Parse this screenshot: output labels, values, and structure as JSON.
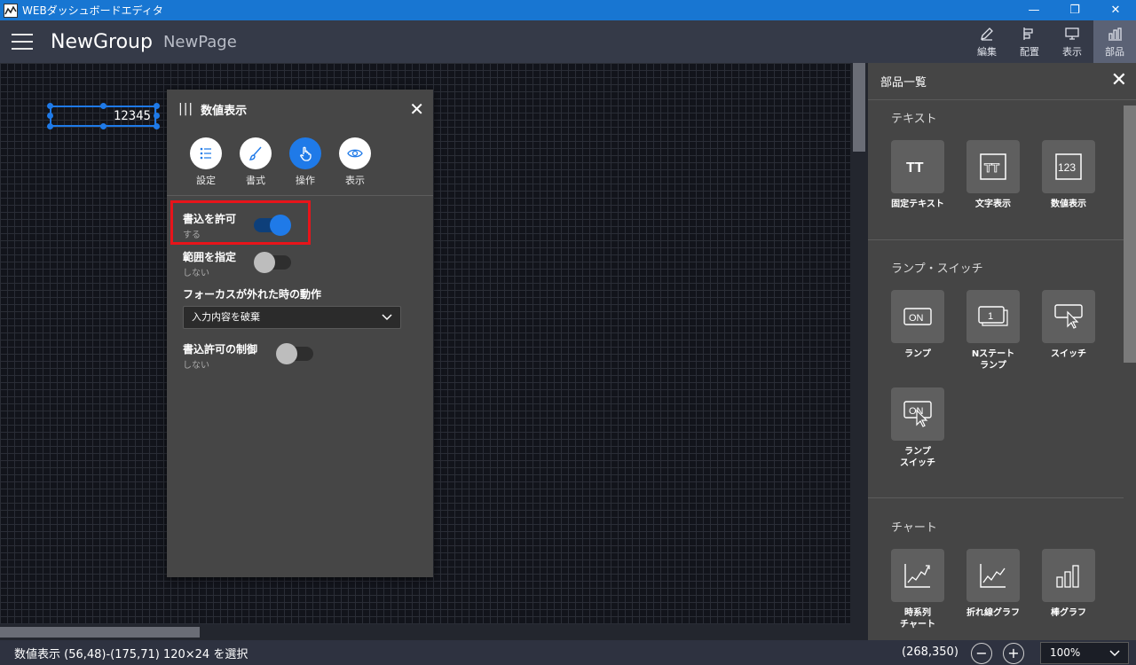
{
  "app": {
    "title": "WEBダッシュボードエディタ"
  },
  "window_controls": {
    "minimize": "—",
    "restore": "❐",
    "close": "✕"
  },
  "header": {
    "group": "NewGroup",
    "page": "NewPage",
    "tools": [
      {
        "label": "編集",
        "icon": "edit-icon"
      },
      {
        "label": "配置",
        "icon": "align-icon"
      },
      {
        "label": "表示",
        "icon": "monitor-icon"
      },
      {
        "label": "部品",
        "icon": "parts-icon",
        "active": true
      }
    ]
  },
  "canvas": {
    "widget_value": "12345"
  },
  "property_panel": {
    "title": "数値表示",
    "tabs": [
      {
        "label": "設定",
        "icon": "list-icon"
      },
      {
        "label": "書式",
        "icon": "brush-icon"
      },
      {
        "label": "操作",
        "icon": "hand-pointer-icon",
        "active": true
      },
      {
        "label": "表示",
        "icon": "eye-icon"
      }
    ],
    "write_allow": {
      "label": "書込を許可",
      "value": "する",
      "on": true
    },
    "range": {
      "label": "範囲を指定",
      "value": "しない",
      "on": false
    },
    "focus_out": {
      "label": "フォーカスが外れた時の動作",
      "selected": "入力内容を破棄"
    },
    "write_control": {
      "label": "書込許可の制御",
      "value": "しない",
      "on": false
    }
  },
  "parts_panel": {
    "title": "部品一覧",
    "sections": [
      {
        "title": "テキスト",
        "items": [
          "固定テキスト",
          "文字表示",
          "数値表示"
        ]
      },
      {
        "title": "ランプ・スイッチ",
        "items": [
          "ランプ",
          "Nステート\nランプ",
          "スイッチ",
          "ランプ\nスイッチ"
        ]
      },
      {
        "title": "チャート",
        "items": [
          "時系列\nチャート",
          "折れ線グラフ",
          "棒グラフ"
        ]
      }
    ]
  },
  "status": {
    "selection": "数値表示 (56,48)-(175,71) 120×24 を選択",
    "cursor": "(268,350)",
    "zoom": "100%",
    "zoom_out": "−",
    "zoom_in": "+"
  },
  "colors": {
    "accent": "#1f7ae8",
    "titlebar": "#1876d2",
    "header": "#353a48",
    "highlight": "#e8141a"
  }
}
